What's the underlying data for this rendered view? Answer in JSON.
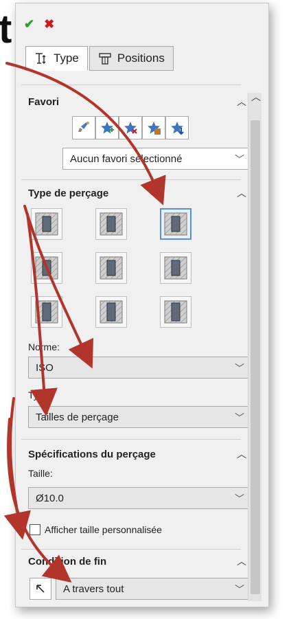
{
  "toolbar": {
    "ok_icon": "checkmark-icon",
    "cancel_icon": "cross-icon"
  },
  "decoration": {
    "big_letter": "t"
  },
  "tabs": [
    {
      "label": "Type",
      "icon": "type-tab-icon",
      "active": true
    },
    {
      "label": "Positions",
      "icon": "positions-tab-icon",
      "active": false
    }
  ],
  "favorites": {
    "title": "Favori",
    "icons": [
      "apply-defaults-icon",
      "add-favorite-icon",
      "delete-favorite-icon",
      "save-favorite-icon",
      "load-favorite-icon"
    ],
    "selected": "Aucun favori sélectionné"
  },
  "hole_type": {
    "title": "Type de perçage",
    "types": [
      "counterbore-icon",
      "countersink-icon",
      "hole-icon",
      "straight-tap-icon",
      "tapered-tap-icon",
      "legacy-hole-icon",
      "counterbore-slot-icon",
      "countersink-slot-icon",
      "slot-icon"
    ],
    "selected_index": 2,
    "standard_label": "Norme:",
    "standard_value": "ISO",
    "type_label": "Type:",
    "type_value": "Tailles de perçage"
  },
  "hole_specs": {
    "title": "Spécifications du perçage",
    "size_label": "Taille:",
    "size_value": "Ø10.0",
    "custom_size_label": "Afficher taille personnalisée",
    "custom_size_checked": false
  },
  "end_condition": {
    "title": "Condition de fin",
    "value": "A travers tout",
    "icon": "reverse-direction-icon"
  },
  "colors": {
    "ok": "#2d9b2d",
    "cancel": "#d0181b",
    "arrow": "#b2352b",
    "selected_border": "#5a8fd6"
  }
}
